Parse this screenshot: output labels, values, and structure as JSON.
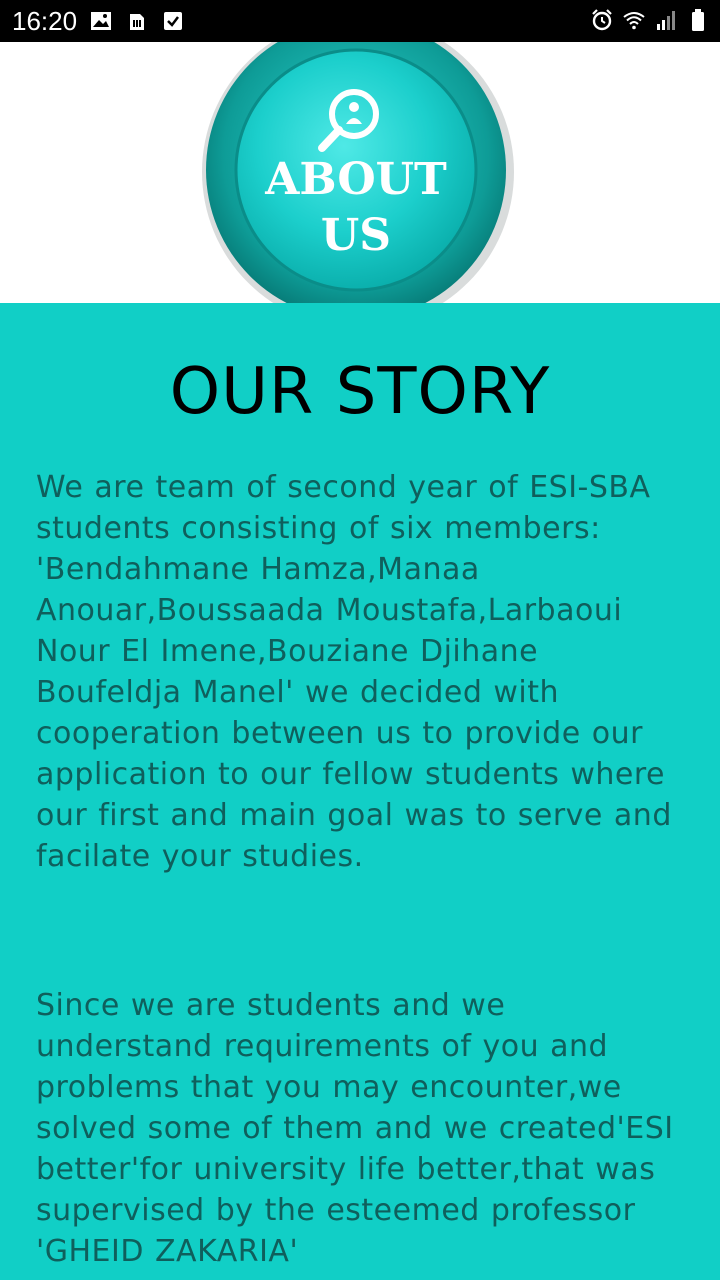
{
  "status_bar": {
    "time": "16:20",
    "left_icons": [
      "image-icon",
      "sim-icon",
      "checkbox-icon"
    ],
    "right_icons": [
      "alarm-icon",
      "wifi-icon",
      "signal-icon",
      "battery-icon"
    ]
  },
  "hero": {
    "badge_line1": "ABOUT",
    "badge_line2": "US",
    "icon": "search-user-icon"
  },
  "story": {
    "title": "OUR STORY",
    "paragraph1": "We are team of second year of ESI-SBA students consisting of six members: 'Bendahmane Hamza,Manaa Anouar,Boussaada Moustafa,Larbaoui Nour El Imene,Bouziane Djihane Boufeldja Manel' we decided with cooperation between us to provide our application to our fellow students where our first and main goal was to serve and facilate your studies.",
    "paragraph2": "Since we are students and we understand requirements of  you and problems that you may encounter,we solved some of them  and we created'ESI better'for university life better,that was supervised by the esteemed professor 'GHEID ZAKARIA'"
  },
  "colors": {
    "background": "#11cfc6",
    "text": "#0f5f5c",
    "badge_outer": "#0f9e98",
    "badge_inner": "#1bd3d1"
  }
}
